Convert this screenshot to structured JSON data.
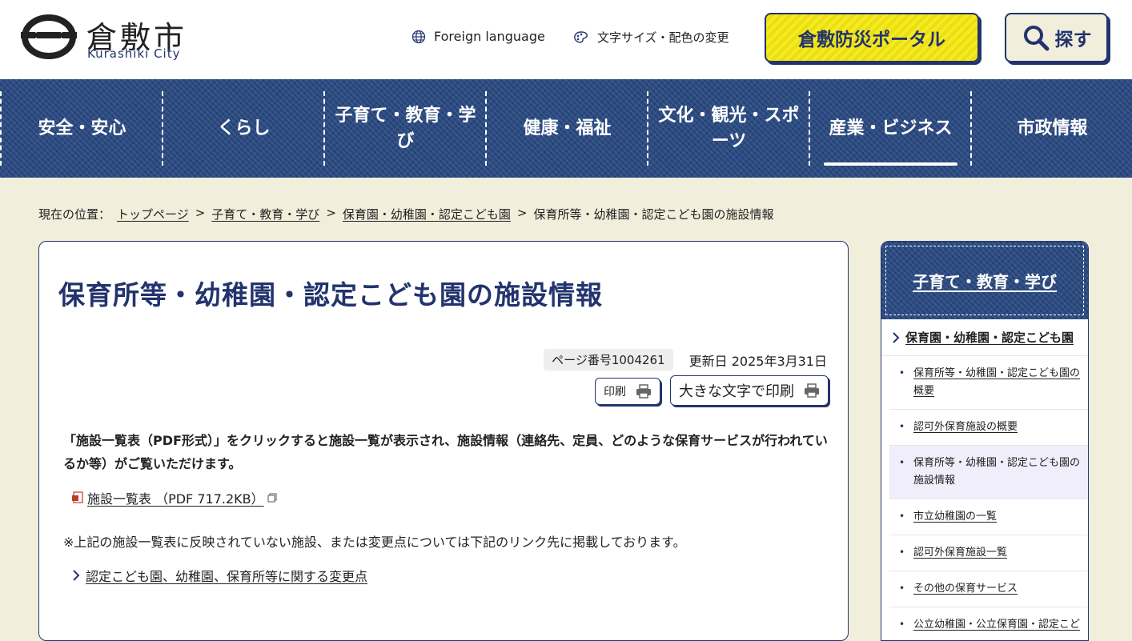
{
  "header": {
    "logo_ja": "倉敷市",
    "logo_en": "Kurashiki City",
    "foreign_language": "Foreign language",
    "font_color_change": "文字サイズ・配色の変更",
    "portal_button": "倉敷防災ポータル",
    "search_button": "探す"
  },
  "nav": {
    "items": [
      {
        "label": "安全・安心"
      },
      {
        "label": "くらし"
      },
      {
        "label": "子育て・教育・学び"
      },
      {
        "label": "健康・福祉"
      },
      {
        "label": "文化・観光・スポーツ"
      },
      {
        "label": "産業・ビジネス",
        "active": true
      },
      {
        "label": "市政情報"
      }
    ]
  },
  "breadcrumb": {
    "prefix": "現在の位置：",
    "items": [
      "トップページ",
      "子育て・教育・学び",
      "保育園・幼稚園・認定こども園"
    ],
    "current": "保育所等・幼稚園・認定こども園の施設情報",
    "separator": ">"
  },
  "main": {
    "title": "保育所等・幼稚園・認定こども園の施設情報",
    "page_number": "ページ番号1004261",
    "updated": "更新日 2025年3月31日",
    "print_label": "印刷",
    "print_large_label": "大きな文字で印刷",
    "body_text": "「施設一覧表（PDF形式）」をクリックすると施設一覧が表示され、施設情報（連絡先、定員、どのような保育サービスが行われているか等）がご覧いただけます。",
    "pdf_link": "施設一覧表 （PDF 717.2KB）",
    "note": "※上記の施設一覧表に反映されていない施設、または変更点については下記のリンク先に掲載しております。",
    "change_link": "認定こども園、幼稚園、保育所等に関する変更点"
  },
  "sidebar": {
    "heading": "子育て・教育・学び",
    "category": "保育園・幼稚園・認定こども園",
    "items": [
      {
        "label": "保育所等・幼稚園・認定こども園の概要"
      },
      {
        "label": "認可外保育施設の概要"
      },
      {
        "label": "保育所等・幼稚園・認定こども園の施設情報",
        "current": true
      },
      {
        "label": "市立幼稚園の一覧"
      },
      {
        "label": "認可外保育施設一覧"
      },
      {
        "label": "その他の保育サービス"
      },
      {
        "label": "公立幼稚園・公立保育園・認定こど"
      }
    ]
  },
  "colors": {
    "navy": "#22336e",
    "nav_bg": "#2a4a82",
    "page_bg": "#f2eedc",
    "portal_yellow": "#f5ea23"
  }
}
